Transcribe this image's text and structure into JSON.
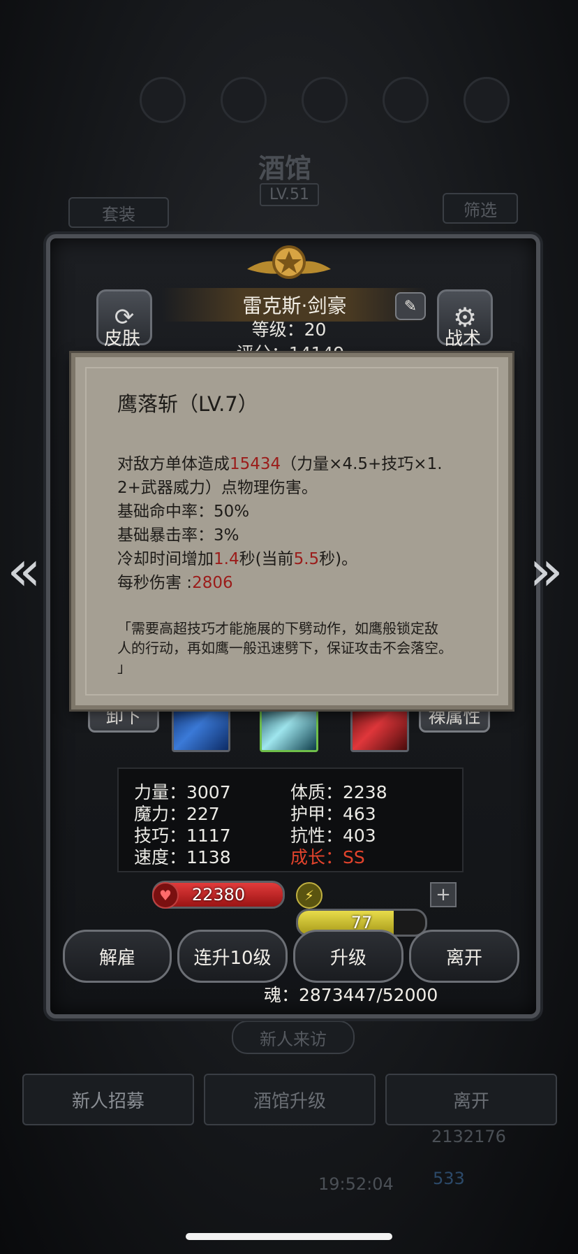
{
  "background": {
    "title": "酒馆",
    "level": "LV.51",
    "suit_label": "套装",
    "filter_label": "筛选",
    "visitor_label": "新人来访",
    "recruit_label": "新人招募",
    "upgrade_tavern_label": "酒馆升级",
    "leave_label": "离开",
    "gold": "2132176",
    "time": "19:52:04",
    "gems": "533"
  },
  "hero": {
    "name": "雷克斯·剑豪",
    "level_text": "等级：20",
    "score_text": "评分：14149",
    "skin_label": "皮肤",
    "tactics_label": "战术",
    "unequip_label": "卸下",
    "naked_attr_label": "裸属性"
  },
  "tooltip": {
    "title": "鹰落斩（LV.7）",
    "desc_prefix": "对敌方单体造成",
    "damage": "15434",
    "desc_suffix": "（力量×4.5+技巧×1.",
    "desc_line2": "2+武器威力）点物理伤害。",
    "hit_rate": "基础命中率：50%",
    "crit_rate": "基础暴击率：3%",
    "cooldown_prefix": "冷却时间增加",
    "cooldown_add": "1.4",
    "cooldown_mid": "秒(当前",
    "cooldown_current": "5.5",
    "cooldown_suffix": "秒)。",
    "dps_prefix": "每秒伤害 :",
    "dps": "2806",
    "flavor_line1": "「需要高超技巧才能施展的下劈动作，如鹰般锁定敌",
    "flavor_line2": "人的行动，再如鹰一般迅速劈下，保证攻击不会落空。",
    "flavor_line3": "」"
  },
  "stats": {
    "strength": "力量：3007",
    "magic": "魔力：227",
    "skill": "技巧：1117",
    "speed": "速度：1138",
    "constitution": "体质：2238",
    "armor": "护甲：463",
    "resistance": "抗性：403",
    "growth": "成长：SS"
  },
  "bars": {
    "hp": "22380",
    "energy": "77",
    "energy_fill_pct": 75
  },
  "actions": {
    "dismiss": "解雇",
    "level10": "连升10级",
    "upgrade": "升级",
    "leave": "离开"
  },
  "soul": "魂：2873447/52000",
  "colors": {
    "accent_red": "#9b1c1a",
    "growth_red": "#e2432c",
    "hp_red": "#c81e1e",
    "energy_yellow": "#d6c631"
  }
}
